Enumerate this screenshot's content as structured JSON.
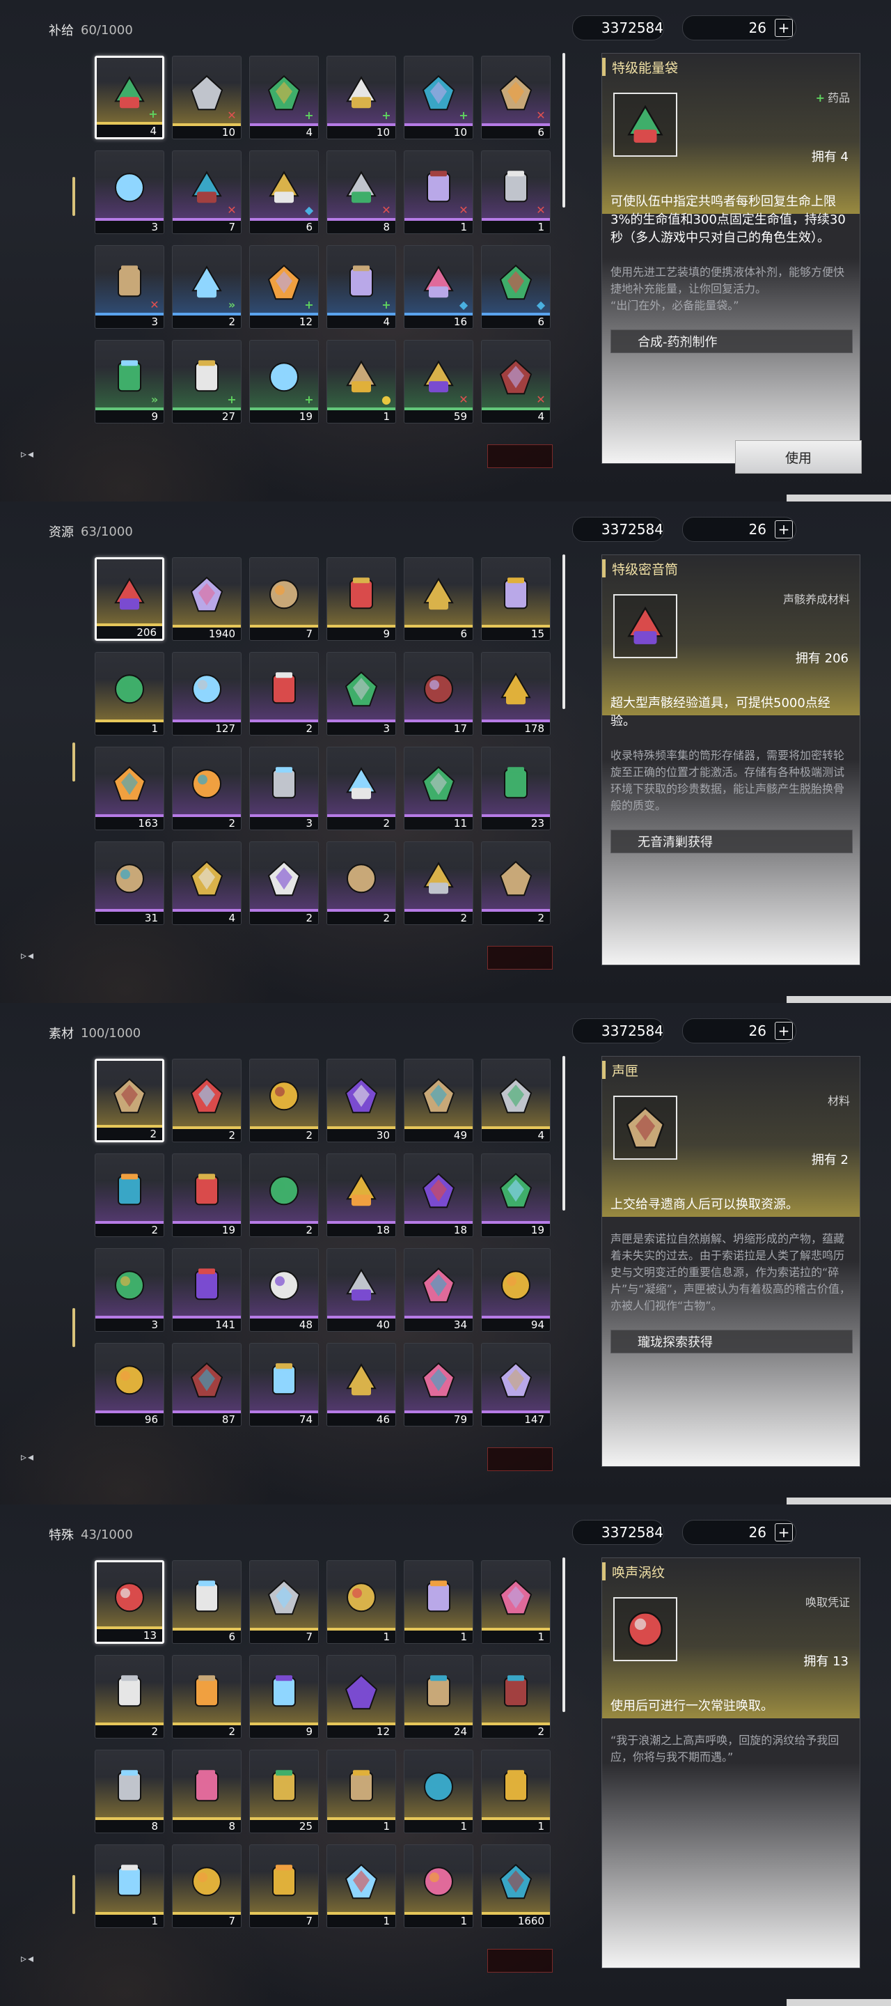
{
  "currency": {
    "coins": "3372584",
    "stars": "26"
  },
  "panels": [
    {
      "category": "补给",
      "count": "60/1000",
      "active_tab": 2,
      "detail": {
        "title": "特级能量袋",
        "type": "药品",
        "owned": "拥有 4",
        "description": "可使队伍中指定共鸣者每秒回复生命上限3%的生命值和300点固定生命值，持续30秒（多人游戏中只对自己的角色生效）。",
        "lore": "使用先进工艺装填的便携液体补剂，能够方便快捷地补充能量，让你回复活力。\n“出门在外，必备能量袋。”",
        "source": "合成-药剂制作",
        "use_button": "使用"
      },
      "items": [
        {
          "name": "energy-bag-gold",
          "qty": "4",
          "rarity": "gold",
          "badge": "plus"
        },
        {
          "name": "layered-pastry",
          "qty": "10",
          "rarity": "gold",
          "badge": "x"
        },
        {
          "name": "green-cake",
          "qty": "4",
          "rarity": "purple",
          "badge": "plus"
        },
        {
          "name": "purple-pill",
          "qty": "10",
          "rarity": "purple",
          "badge": "plus"
        },
        {
          "name": "purple-bag",
          "qty": "10",
          "rarity": "purple",
          "badge": "plus"
        },
        {
          "name": "gold-fruit",
          "qty": "6",
          "rarity": "purple",
          "badge": "x"
        },
        {
          "name": "gold-cube",
          "qty": "3",
          "rarity": "purple",
          "badge": ""
        },
        {
          "name": "gold-cube-2",
          "qty": "7",
          "rarity": "purple",
          "badge": "x"
        },
        {
          "name": "red-can",
          "qty": "6",
          "rarity": "purple",
          "badge": "shield"
        },
        {
          "name": "red-bag",
          "qty": "8",
          "rarity": "purple",
          "badge": "x"
        },
        {
          "name": "dark-bag",
          "qty": "1",
          "rarity": "purple",
          "badge": "x"
        },
        {
          "name": "purple-bag-2",
          "qty": "1",
          "rarity": "purple",
          "badge": "x"
        },
        {
          "name": "blue-bag",
          "qty": "3",
          "rarity": "blue",
          "badge": "x"
        },
        {
          "name": "cyan-magnet",
          "qty": "2",
          "rarity": "blue",
          "badge": "run"
        },
        {
          "name": "white-pill",
          "qty": "12",
          "rarity": "blue",
          "badge": "plus"
        },
        {
          "name": "teal-bag",
          "qty": "4",
          "rarity": "blue",
          "badge": "plus"
        },
        {
          "name": "pancake",
          "qty": "16",
          "rarity": "blue",
          "badge": "shield"
        },
        {
          "name": "orange-bun",
          "qty": "6",
          "rarity": "blue",
          "badge": "shield"
        },
        {
          "name": "green-magnet",
          "qty": "9",
          "rarity": "green",
          "badge": "run"
        },
        {
          "name": "white-pill-2",
          "qty": "27",
          "rarity": "green",
          "badge": "plus"
        },
        {
          "name": "green-bag",
          "qty": "19",
          "rarity": "green",
          "badge": "plus"
        },
        {
          "name": "bottle-pink",
          "qty": "1",
          "rarity": "green",
          "badge": "bulb"
        },
        {
          "name": "skewers",
          "qty": "59",
          "rarity": "green",
          "badge": "x"
        },
        {
          "name": "plate-dish",
          "qty": "4",
          "rarity": "green",
          "badge": "x"
        }
      ]
    },
    {
      "category": "资源",
      "count": "63/1000",
      "active_tab": 3,
      "detail": {
        "title": "特级密音筒",
        "type": "声骸养成材料",
        "owned": "拥有 206",
        "description": "超大型声骸经验道具，可提供5000点经验。",
        "lore": "收录特殊频率集的筒形存储器，需要将加密转轮旋至正确的位置才能激活。存储有各种极端测试环境下获取的珍贵数据，能让声骸产生脱胎换骨般的质变。",
        "source": "无音清剿获得",
        "use_button": ""
      },
      "items": [
        {
          "name": "sonance-casket-gold",
          "qty": "206",
          "rarity": "gold",
          "badge": ""
        },
        {
          "name": "copper-gem",
          "qty": "1940",
          "rarity": "gold",
          "badge": ""
        },
        {
          "name": "amber-orb",
          "qty": "7",
          "rarity": "gold",
          "badge": ""
        },
        {
          "name": "red-ring",
          "qty": "9",
          "rarity": "gold",
          "badge": ""
        },
        {
          "name": "ice-crystal",
          "qty": "6",
          "rarity": "gold",
          "badge": ""
        },
        {
          "name": "red-rock",
          "qty": "15",
          "rarity": "gold",
          "badge": ""
        },
        {
          "name": "roll-tube",
          "qty": "1",
          "rarity": "gold",
          "badge": ""
        },
        {
          "name": "cane-tube",
          "qty": "127",
          "rarity": "purple",
          "badge": ""
        },
        {
          "name": "wind-orb",
          "qty": "2",
          "rarity": "purple",
          "badge": ""
        },
        {
          "name": "fire-bloom",
          "qty": "3",
          "rarity": "purple",
          "badge": ""
        },
        {
          "name": "ember-orb",
          "qty": "17",
          "rarity": "purple",
          "badge": ""
        },
        {
          "name": "purple-tube",
          "qty": "178",
          "rarity": "purple",
          "badge": ""
        },
        {
          "name": "violet-gem",
          "qty": "163",
          "rarity": "purple",
          "badge": ""
        },
        {
          "name": "gold-star",
          "qty": "2",
          "rarity": "purple",
          "badge": ""
        },
        {
          "name": "dark-orb",
          "qty": "3",
          "rarity": "purple",
          "badge": ""
        },
        {
          "name": "silver-ring",
          "qty": "2",
          "rarity": "purple",
          "badge": ""
        },
        {
          "name": "gold-crate",
          "qty": "11",
          "rarity": "purple",
          "badge": ""
        },
        {
          "name": "cyan-crystal",
          "qty": "23",
          "rarity": "purple",
          "badge": ""
        },
        {
          "name": "mech-core",
          "qty": "31",
          "rarity": "purple",
          "badge": ""
        },
        {
          "name": "spark-blue",
          "qty": "4",
          "rarity": "purple",
          "badge": ""
        },
        {
          "name": "spark-gold",
          "qty": "2",
          "rarity": "purple",
          "badge": ""
        },
        {
          "name": "spark-red",
          "qty": "2",
          "rarity": "purple",
          "badge": ""
        },
        {
          "name": "green-shard",
          "qty": "2",
          "rarity": "purple",
          "badge": ""
        },
        {
          "name": "flame-wisp",
          "qty": "2",
          "rarity": "purple",
          "badge": ""
        }
      ]
    },
    {
      "category": "素材",
      "count": "100/1000",
      "active_tab": 4,
      "detail": {
        "title": "声匣",
        "type": "材料",
        "owned": "拥有 2",
        "description": "上交给寻遗商人后可以换取资源。",
        "lore": "声匣是索诺拉自然崩解、坍缩形成的产物，蕴藏着未失实的过去。由于索诺拉是人类了解悲鸣历史与文明变迁的重要信息源，作为索诺拉的“碎片”与“凝缩”，声匣被认为有着极高的稽古价值，亦被人们视作“古物”。",
        "source": "瓏珑探索获得",
        "use_button": ""
      },
      "items": [
        {
          "name": "sound-cube",
          "qty": "2",
          "rarity": "gold",
          "badge": ""
        },
        {
          "name": "gold-flame",
          "qty": "2",
          "rarity": "gold",
          "badge": ""
        },
        {
          "name": "tech-card",
          "qty": "2",
          "rarity": "gold",
          "badge": ""
        },
        {
          "name": "amber-vial",
          "qty": "30",
          "rarity": "gold",
          "badge": ""
        },
        {
          "name": "steel-cube",
          "qty": "49",
          "rarity": "gold",
          "badge": ""
        },
        {
          "name": "prism-gold",
          "qty": "4",
          "rarity": "gold",
          "badge": ""
        },
        {
          "name": "blue-crystal",
          "qty": "2",
          "rarity": "purple",
          "badge": ""
        },
        {
          "name": "amber-bottle",
          "qty": "19",
          "rarity": "purple",
          "badge": ""
        },
        {
          "name": "soup-bowl",
          "qty": "2",
          "rarity": "purple",
          "badge": ""
        },
        {
          "name": "prism-white",
          "qty": "18",
          "rarity": "purple",
          "badge": ""
        },
        {
          "name": "blue-crystal-2",
          "qty": "18",
          "rarity": "purple",
          "badge": ""
        },
        {
          "name": "hotpot",
          "qty": "19",
          "rarity": "purple",
          "badge": ""
        },
        {
          "name": "green-pyramid",
          "qty": "3",
          "rarity": "purple",
          "badge": ""
        },
        {
          "name": "eggs",
          "qty": "141",
          "rarity": "purple",
          "badge": ""
        },
        {
          "name": "apple",
          "qty": "48",
          "rarity": "purple",
          "badge": ""
        },
        {
          "name": "blue-flower",
          "qty": "40",
          "rarity": "purple",
          "badge": ""
        },
        {
          "name": "herb-sprig",
          "qty": "34",
          "rarity": "purple",
          "badge": ""
        },
        {
          "name": "lemon",
          "qty": "94",
          "rarity": "purple",
          "badge": ""
        },
        {
          "name": "pink-lily",
          "qty": "96",
          "rarity": "purple",
          "badge": ""
        },
        {
          "name": "red-flower",
          "qty": "87",
          "rarity": "purple",
          "badge": ""
        },
        {
          "name": "mushroom",
          "qty": "74",
          "rarity": "purple",
          "badge": ""
        },
        {
          "name": "white-daisy",
          "qty": "46",
          "rarity": "purple",
          "badge": ""
        },
        {
          "name": "coral-twig",
          "qty": "79",
          "rarity": "purple",
          "badge": ""
        },
        {
          "name": "gold-berry",
          "qty": "147",
          "rarity": "purple",
          "badge": ""
        }
      ]
    },
    {
      "category": "特殊",
      "count": "43/1000",
      "active_tab": 5,
      "detail": {
        "title": "唤声涡纹",
        "type": "唤取凭证",
        "owned": "拥有 13",
        "description": "使用后可进行一次常驻唤取。",
        "lore": "“我于浪潮之上高声呼唤，回旋的涡纹给予我回应，你将与我不期而遇。”",
        "source": "",
        "use_button": ""
      },
      "items": [
        {
          "name": "lustrous-tide",
          "qty": "13",
          "rarity": "gold",
          "badge": ""
        },
        {
          "name": "coral-branch",
          "qty": "6",
          "rarity": "gold",
          "badge": ""
        },
        {
          "name": "gold-sword",
          "qty": "7",
          "rarity": "gold",
          "badge": ""
        },
        {
          "name": "pink-portrait",
          "qty": "1",
          "rarity": "gold",
          "badge": ""
        },
        {
          "name": "green-shield",
          "qty": "1",
          "rarity": "gold",
          "badge": ""
        },
        {
          "name": "supply-box",
          "qty": "1",
          "rarity": "gold",
          "badge": ""
        },
        {
          "name": "supply-box-2",
          "qty": "2",
          "rarity": "gold",
          "badge": ""
        },
        {
          "name": "supply-box-3",
          "qty": "2",
          "rarity": "gold",
          "badge": ""
        },
        {
          "name": "supply-box-4",
          "qty": "9",
          "rarity": "gold",
          "badge": ""
        },
        {
          "name": "gold-chest",
          "qty": "12",
          "rarity": "gold",
          "badge": ""
        },
        {
          "name": "gold-chest-2",
          "qty": "24",
          "rarity": "gold",
          "badge": ""
        },
        {
          "name": "supply-box-5",
          "qty": "2",
          "rarity": "gold",
          "badge": ""
        },
        {
          "name": "supply-box-6",
          "qty": "8",
          "rarity": "gold",
          "badge": ""
        },
        {
          "name": "supply-box-7",
          "qty": "8",
          "rarity": "gold",
          "badge": ""
        },
        {
          "name": "supply-box-8",
          "qty": "25",
          "rarity": "gold",
          "badge": ""
        },
        {
          "name": "supply-box-9",
          "qty": "1",
          "rarity": "gold",
          "badge": ""
        },
        {
          "name": "supply-box-10",
          "qty": "1",
          "rarity": "gold",
          "badge": ""
        },
        {
          "name": "ticket-strip",
          "qty": "1",
          "rarity": "gold",
          "badge": ""
        },
        {
          "name": "violet-shard",
          "qty": "1",
          "rarity": "gold",
          "badge": ""
        },
        {
          "name": "gold-dust",
          "qty": "7",
          "rarity": "gold",
          "badge": ""
        },
        {
          "name": "tent-box",
          "qty": "7",
          "rarity": "gold",
          "badge": ""
        },
        {
          "name": "blue-medal",
          "qty": "1",
          "rarity": "gold",
          "badge": ""
        },
        {
          "name": "blue-card",
          "qty": "1",
          "rarity": "gold",
          "badge": ""
        },
        {
          "name": "cyan-coral",
          "qty": "1660",
          "rarity": "gold",
          "badge": ""
        }
      ]
    }
  ]
}
